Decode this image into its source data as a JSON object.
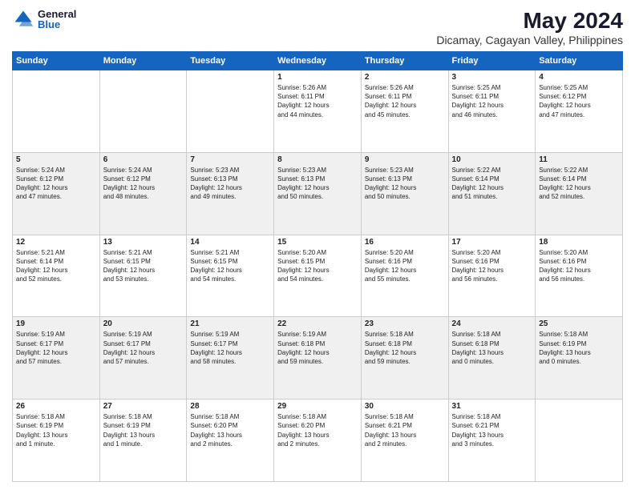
{
  "logo": {
    "general": "General",
    "blue": "Blue"
  },
  "header": {
    "title": "May 2024",
    "subtitle": "Dicamay, Cagayan Valley, Philippines"
  },
  "weekdays": [
    "Sunday",
    "Monday",
    "Tuesday",
    "Wednesday",
    "Thursday",
    "Friday",
    "Saturday"
  ],
  "weeks": [
    [
      {
        "day": "",
        "info": ""
      },
      {
        "day": "",
        "info": ""
      },
      {
        "day": "",
        "info": ""
      },
      {
        "day": "1",
        "info": "Sunrise: 5:26 AM\nSunset: 6:11 PM\nDaylight: 12 hours\nand 44 minutes."
      },
      {
        "day": "2",
        "info": "Sunrise: 5:26 AM\nSunset: 6:11 PM\nDaylight: 12 hours\nand 45 minutes."
      },
      {
        "day": "3",
        "info": "Sunrise: 5:25 AM\nSunset: 6:11 PM\nDaylight: 12 hours\nand 46 minutes."
      },
      {
        "day": "4",
        "info": "Sunrise: 5:25 AM\nSunset: 6:12 PM\nDaylight: 12 hours\nand 47 minutes."
      }
    ],
    [
      {
        "day": "5",
        "info": "Sunrise: 5:24 AM\nSunset: 6:12 PM\nDaylight: 12 hours\nand 47 minutes."
      },
      {
        "day": "6",
        "info": "Sunrise: 5:24 AM\nSunset: 6:12 PM\nDaylight: 12 hours\nand 48 minutes."
      },
      {
        "day": "7",
        "info": "Sunrise: 5:23 AM\nSunset: 6:13 PM\nDaylight: 12 hours\nand 49 minutes."
      },
      {
        "day": "8",
        "info": "Sunrise: 5:23 AM\nSunset: 6:13 PM\nDaylight: 12 hours\nand 50 minutes."
      },
      {
        "day": "9",
        "info": "Sunrise: 5:23 AM\nSunset: 6:13 PM\nDaylight: 12 hours\nand 50 minutes."
      },
      {
        "day": "10",
        "info": "Sunrise: 5:22 AM\nSunset: 6:14 PM\nDaylight: 12 hours\nand 51 minutes."
      },
      {
        "day": "11",
        "info": "Sunrise: 5:22 AM\nSunset: 6:14 PM\nDaylight: 12 hours\nand 52 minutes."
      }
    ],
    [
      {
        "day": "12",
        "info": "Sunrise: 5:21 AM\nSunset: 6:14 PM\nDaylight: 12 hours\nand 52 minutes."
      },
      {
        "day": "13",
        "info": "Sunrise: 5:21 AM\nSunset: 6:15 PM\nDaylight: 12 hours\nand 53 minutes."
      },
      {
        "day": "14",
        "info": "Sunrise: 5:21 AM\nSunset: 6:15 PM\nDaylight: 12 hours\nand 54 minutes."
      },
      {
        "day": "15",
        "info": "Sunrise: 5:20 AM\nSunset: 6:15 PM\nDaylight: 12 hours\nand 54 minutes."
      },
      {
        "day": "16",
        "info": "Sunrise: 5:20 AM\nSunset: 6:16 PM\nDaylight: 12 hours\nand 55 minutes."
      },
      {
        "day": "17",
        "info": "Sunrise: 5:20 AM\nSunset: 6:16 PM\nDaylight: 12 hours\nand 56 minutes."
      },
      {
        "day": "18",
        "info": "Sunrise: 5:20 AM\nSunset: 6:16 PM\nDaylight: 12 hours\nand 56 minutes."
      }
    ],
    [
      {
        "day": "19",
        "info": "Sunrise: 5:19 AM\nSunset: 6:17 PM\nDaylight: 12 hours\nand 57 minutes."
      },
      {
        "day": "20",
        "info": "Sunrise: 5:19 AM\nSunset: 6:17 PM\nDaylight: 12 hours\nand 57 minutes."
      },
      {
        "day": "21",
        "info": "Sunrise: 5:19 AM\nSunset: 6:17 PM\nDaylight: 12 hours\nand 58 minutes."
      },
      {
        "day": "22",
        "info": "Sunrise: 5:19 AM\nSunset: 6:18 PM\nDaylight: 12 hours\nand 59 minutes."
      },
      {
        "day": "23",
        "info": "Sunrise: 5:18 AM\nSunset: 6:18 PM\nDaylight: 12 hours\nand 59 minutes."
      },
      {
        "day": "24",
        "info": "Sunrise: 5:18 AM\nSunset: 6:18 PM\nDaylight: 13 hours\nand 0 minutes."
      },
      {
        "day": "25",
        "info": "Sunrise: 5:18 AM\nSunset: 6:19 PM\nDaylight: 13 hours\nand 0 minutes."
      }
    ],
    [
      {
        "day": "26",
        "info": "Sunrise: 5:18 AM\nSunset: 6:19 PM\nDaylight: 13 hours\nand 1 minute."
      },
      {
        "day": "27",
        "info": "Sunrise: 5:18 AM\nSunset: 6:19 PM\nDaylight: 13 hours\nand 1 minute."
      },
      {
        "day": "28",
        "info": "Sunrise: 5:18 AM\nSunset: 6:20 PM\nDaylight: 13 hours\nand 2 minutes."
      },
      {
        "day": "29",
        "info": "Sunrise: 5:18 AM\nSunset: 6:20 PM\nDaylight: 13 hours\nand 2 minutes."
      },
      {
        "day": "30",
        "info": "Sunrise: 5:18 AM\nSunset: 6:21 PM\nDaylight: 13 hours\nand 2 minutes."
      },
      {
        "day": "31",
        "info": "Sunrise: 5:18 AM\nSunset: 6:21 PM\nDaylight: 13 hours\nand 3 minutes."
      },
      {
        "day": "",
        "info": ""
      }
    ]
  ]
}
